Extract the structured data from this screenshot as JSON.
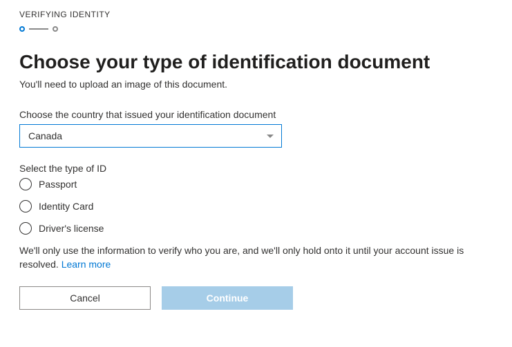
{
  "stepLabel": "VERIFYING IDENTITY",
  "title": "Choose your type of identification document",
  "subtitle": "You'll need to upload an image of this document.",
  "countryLabel": "Choose the country that issued your identification document",
  "countryValue": "Canada",
  "idTypeLabel": "Select the type of ID",
  "idOptions": [
    "Passport",
    "Identity Card",
    "Driver's license"
  ],
  "disclaimer": "We'll only use the information to verify who you are, and we'll only hold onto it until your account issue is resolved. ",
  "learnMore": "Learn more",
  "cancel": "Cancel",
  "continue": "Continue"
}
